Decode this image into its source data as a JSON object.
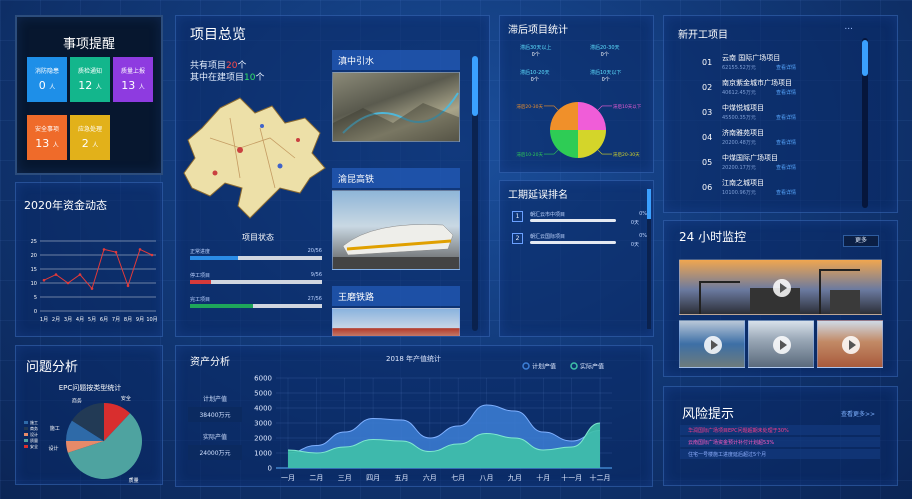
{
  "reminder": {
    "title": "事项提醒",
    "tiles": [
      {
        "label": "消防隐患",
        "count": "0",
        "unit": "人",
        "color": "#1e8fe8"
      },
      {
        "label": "质检通知",
        "count": "12",
        "unit": "人",
        "color": "#13b68c"
      },
      {
        "label": "质量上报",
        "count": "13",
        "unit": "人",
        "color": "#8e3be0"
      },
      {
        "label": "安全事项",
        "count": "13",
        "unit": "人",
        "color": "#ef6b2a"
      },
      {
        "label": "应急处理",
        "count": "2",
        "unit": "人",
        "color": "#e2b11a"
      }
    ]
  },
  "fund": {
    "title": "2020年资金动态",
    "chart_data": {
      "type": "line",
      "categories": [
        "1月",
        "2月",
        "3月",
        "4月",
        "5月",
        "6月",
        "7月",
        "8月",
        "9月",
        "10月"
      ],
      "values": [
        11,
        13,
        10,
        13,
        8,
        22,
        21,
        9,
        22,
        20
      ],
      "ylim": [
        0,
        25
      ],
      "yticks": [
        "0",
        "5",
        "10",
        "15",
        "20",
        "25"
      ],
      "grid": true
    }
  },
  "problem": {
    "title": "问题分析",
    "chart_data": {
      "type": "pie",
      "title": "EPC问题按类型统计",
      "labels": [
        "安全",
        "质量",
        "设计",
        "施工",
        "商务"
      ],
      "values": [
        12,
        58,
        5,
        9,
        16
      ],
      "colors": [
        "#d92e2e",
        "#4ea3a0",
        "#e78a69",
        "#2e6aa8",
        "#223a55"
      ],
      "legend": [
        "施工",
        "商务",
        "设计",
        "质量",
        "安全"
      ]
    }
  },
  "overview": {
    "title": "项目总览",
    "line1_prefix": "共有项目",
    "line1_num": "20",
    "line1_suffix": "个",
    "line2_prefix": "其中在建项目",
    "line2_num": "10",
    "line2_suffix": "个",
    "status_title": "项目状态",
    "statuses": [
      {
        "label": "正常进度",
        "value": "20/56",
        "frac": 0.36,
        "color": "#2b8ce6"
      },
      {
        "label": "停工项目",
        "value": "9/56",
        "frac": 0.16,
        "color": "#d63a3a"
      },
      {
        "label": "完工项目",
        "value": "27/56",
        "frac": 0.48,
        "color": "#1ea65a"
      }
    ],
    "projects": [
      "滇中引水",
      "渝昆高铁",
      "王磨铁路"
    ]
  },
  "delay": {
    "title": "滞后项目统计",
    "items": [
      {
        "label": "滞后30天以上",
        "value": "0个"
      },
      {
        "label": "滞后20-30天",
        "value": "0个"
      },
      {
        "label": "滞后10-20天",
        "value": "0个"
      },
      {
        "label": "滞后10天以下",
        "value": "0个"
      }
    ],
    "chart_data": {
      "type": "pie",
      "labels": [
        "滞后10天以下",
        "滞后20-30天",
        "滞后10-20天",
        "滞后20-30天"
      ],
      "values": [
        25,
        25,
        25,
        25
      ],
      "colors": [
        "#f05dd8",
        "#d4d52a",
        "#2ecc55",
        "#f0902a"
      ]
    }
  },
  "rank": {
    "title": "工期延误排名",
    "items": [
      {
        "num": "1",
        "name": "朝汇云市中项目",
        "pct": "0%",
        "days": "0天"
      },
      {
        "num": "2",
        "name": "朝汇云国际项目",
        "pct": "0%",
        "days": "0天"
      }
    ]
  },
  "newproj": {
    "title": "新开工项目",
    "more": "...",
    "items": [
      {
        "num": "01",
        "name": "云南   国际广场项目",
        "meta": "62155.52万元",
        "link": "查看详情"
      },
      {
        "num": "02",
        "name": "南京紫金城市广场项目",
        "meta": "40612.45万元",
        "link": "查看详情"
      },
      {
        "num": "03",
        "name": "中煤悦城项目",
        "meta": "45500.35万元",
        "link": "查看详情"
      },
      {
        "num": "04",
        "name": "济南雅苑项目",
        "meta": "20200.48万元",
        "link": "查看详情"
      },
      {
        "num": "05",
        "name": "中煤国际广场项目",
        "meta": "20200.17万元",
        "link": "查看详情"
      },
      {
        "num": "06",
        "name": "江南之城项目",
        "meta": "10100.96万元",
        "link": "查看详情"
      }
    ]
  },
  "monitor": {
    "title": "24 小时监控",
    "more": "更多"
  },
  "risk": {
    "title": "风险提示",
    "more": "查看更多>>",
    "items": [
      {
        "text": "华润国际广场项目EPC问题超期未处理于30%",
        "color": "#ff3d8a"
      },
      {
        "text": "云南国际广场资金预计补付计划超53%",
        "color": "#ff5abf"
      },
      {
        "text": "住宅一号楼施工进度延后超过5个月",
        "color": "#8fb0ff"
      }
    ]
  },
  "assets": {
    "title": "资产分析",
    "plan_label": "计划产值",
    "plan_value": "38400万元",
    "actual_label": "实际产值",
    "actual_value": "24000万元",
    "chart_data": {
      "type": "area",
      "title": "2018 年产值统计",
      "categories": [
        "一月",
        "二月",
        "三月",
        "四月",
        "五月",
        "六月",
        "七月",
        "八月",
        "九月",
        "十月",
        "十一月",
        "十二月"
      ],
      "series": [
        {
          "name": "计划产值",
          "values": [
            1000,
            1500,
            2400,
            3300,
            3200,
            2000,
            2800,
            4200,
            3800,
            2400,
            1800,
            2500
          ],
          "color": "#3d7fd6"
        },
        {
          "name": "实际产值",
          "values": [
            1200,
            1000,
            1400,
            1900,
            1800,
            1100,
            1600,
            2300,
            2000,
            1200,
            1400,
            3000
          ],
          "color": "#3fc1a8"
        }
      ],
      "ylim": [
        0,
        6000
      ],
      "yticks": [
        "0",
        "1000",
        "2000",
        "3000",
        "4000",
        "5000",
        "6000"
      ]
    }
  }
}
